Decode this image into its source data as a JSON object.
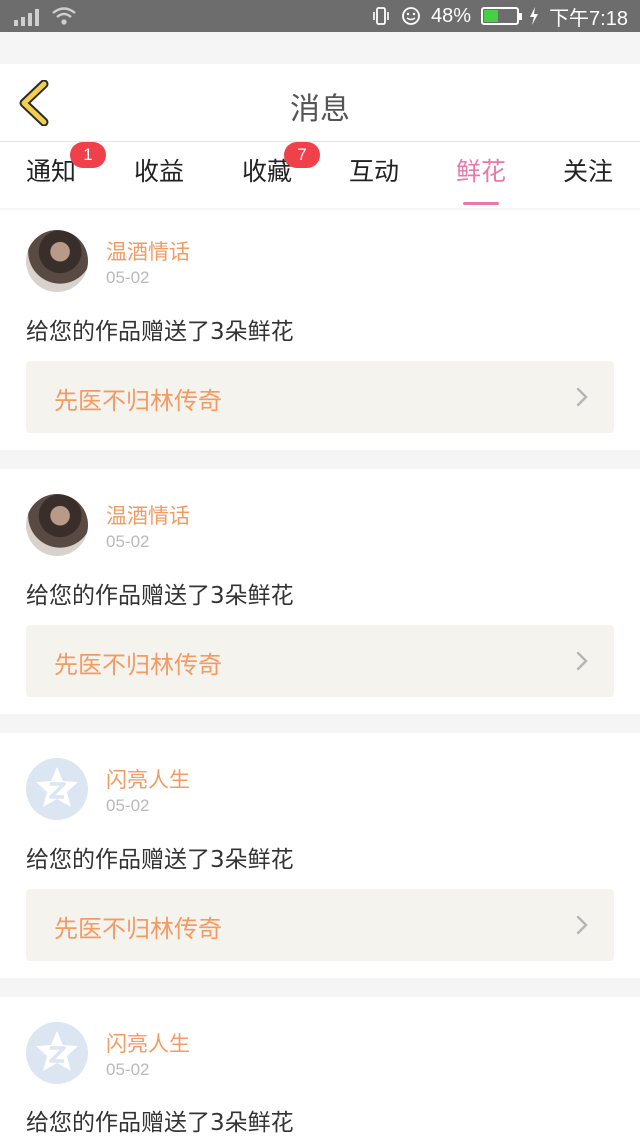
{
  "status_bar": {
    "battery_percent": "48%",
    "battery_level": 0.48,
    "time": "下午7:18",
    "battery_color": "#46d046"
  },
  "header": {
    "title": "消息",
    "back_icon": "chevron-left-icon"
  },
  "tabs": [
    {
      "label": "通知",
      "badge": "1",
      "active": false
    },
    {
      "label": "收益",
      "badge": "",
      "active": false
    },
    {
      "label": "收藏",
      "badge": "7",
      "active": false
    },
    {
      "label": "互动",
      "badge": "",
      "active": false
    },
    {
      "label": "鲜花",
      "badge": "",
      "active": true
    },
    {
      "label": "关注",
      "badge": "",
      "active": false
    }
  ],
  "messages": [
    {
      "user": "温酒情话",
      "date": "05-02",
      "text": "给您的作品赠送了3朵鲜花",
      "work": "先医不归林传奇",
      "avatar": "photo"
    },
    {
      "user": "温酒情话",
      "date": "05-02",
      "text": "给您的作品赠送了3朵鲜花",
      "work": "先医不归林传奇",
      "avatar": "photo"
    },
    {
      "user": "闪亮人生",
      "date": "05-02",
      "text": "给您的作品赠送了3朵鲜花",
      "work": "先医不归林传奇",
      "avatar": "default"
    },
    {
      "user": "闪亮人生",
      "date": "05-02",
      "text": "给您的作品赠送了3朵鲜花",
      "work": "",
      "avatar": "default"
    }
  ],
  "colors": {
    "accent_pink": "#e77aa8",
    "username_orange": "#f39b63",
    "badge_red": "#f0404a",
    "back_yellow": "#f2d04a"
  }
}
